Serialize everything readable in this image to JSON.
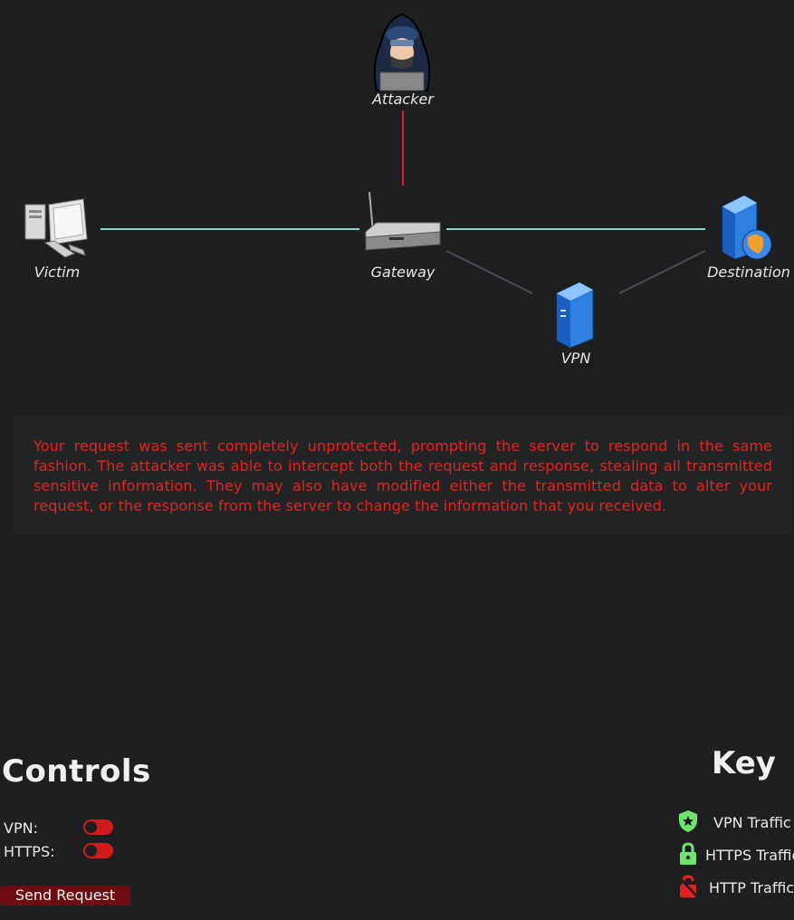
{
  "diagram": {
    "nodes": {
      "attacker": "Attacker",
      "victim": "Victim",
      "gateway": "Gateway",
      "destination": "Destination",
      "vpn": "VPN"
    },
    "colors": {
      "unprotected_link": "#8fd3cf",
      "attack_link": "#e01c1c",
      "idle_link": "#4a4c50"
    }
  },
  "message": {
    "text": "Your request was sent completely unprotected, prompting the server to respond in the same fashion. The attacker was able to intercept both the request and response, stealing all transmitted sensitive information. They may also have modified either the transmitted data to alter your request, or the response from the server to change the information that you received.",
    "color": "#e0231d"
  },
  "controls": {
    "title": "Controls",
    "vpn_label": "VPN:",
    "https_label": "HTTPS:",
    "vpn_on": false,
    "https_on": false,
    "send_label": "Send Request"
  },
  "key": {
    "title": "Key",
    "items": [
      {
        "label": "VPN Traffic",
        "icon": "shield-star-icon",
        "color": "#6ee36e"
      },
      {
        "label": "HTTPS Traffic",
        "icon": "lock-icon",
        "color": "#6ee36e"
      },
      {
        "label": "HTTP Traffic",
        "icon": "unlocked-icon",
        "color": "#e0231d"
      }
    ]
  }
}
